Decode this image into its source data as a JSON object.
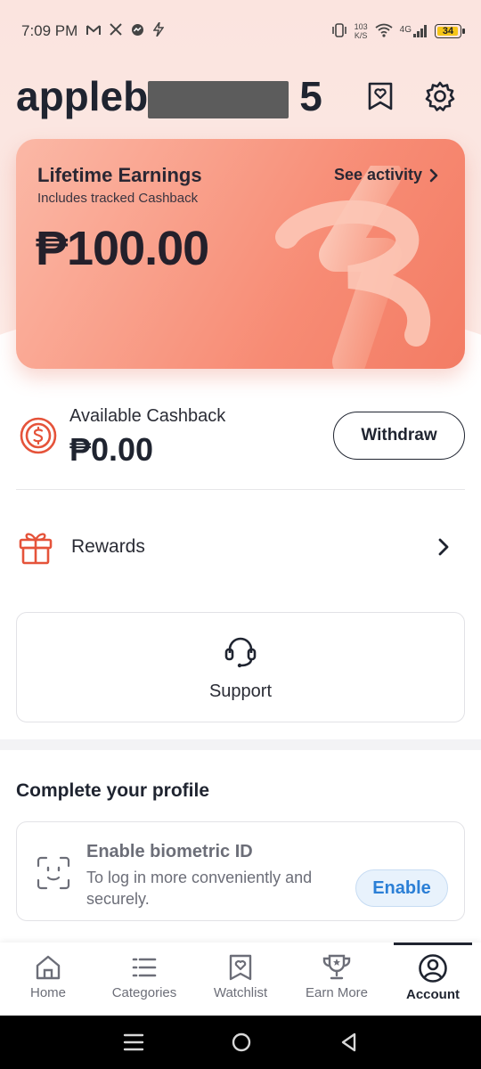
{
  "status_bar": {
    "time": "7:09 PM",
    "net_speed_value": "103",
    "net_speed_unit": "K/S",
    "network": "4G",
    "battery": "34",
    "battery_level": 0.34,
    "left_icons": [
      "gmail-icon",
      "x-icon",
      "messenger-icon",
      "lightning-icon"
    ]
  },
  "header": {
    "username": "appleb5",
    "icons": [
      "watchlist-icon",
      "settings-icon"
    ]
  },
  "earnings": {
    "title": "Lifetime Earnings",
    "subtitle": "Includes tracked Cashback",
    "amount": "₱100.00",
    "see_activity": "See activity"
  },
  "cashback": {
    "label": "Available Cashback",
    "amount": "₱0.00",
    "withdraw": "Withdraw"
  },
  "rewards": {
    "label": "Rewards"
  },
  "support": {
    "label": "Support"
  },
  "profile": {
    "title": "Complete your profile",
    "biometric_title": "Enable biometric ID",
    "biometric_desc": "To log in more conveniently and securely.",
    "enable": "Enable"
  },
  "nav": {
    "items": [
      {
        "label": "Home",
        "icon": "home-icon"
      },
      {
        "label": "Categories",
        "icon": "categories-icon"
      },
      {
        "label": "Watchlist",
        "icon": "watchlist-icon"
      },
      {
        "label": "Earn More",
        "icon": "trophy-icon"
      },
      {
        "label": "Account",
        "icon": "account-icon"
      }
    ],
    "active": "Account"
  },
  "colors": {
    "card_gradient_start": "#fbb8a6",
    "card_gradient_end": "#f37c64",
    "accent_red": "#e5533a",
    "enable_blue": "#2b7fd6",
    "text_dark": "#1f2430"
  }
}
